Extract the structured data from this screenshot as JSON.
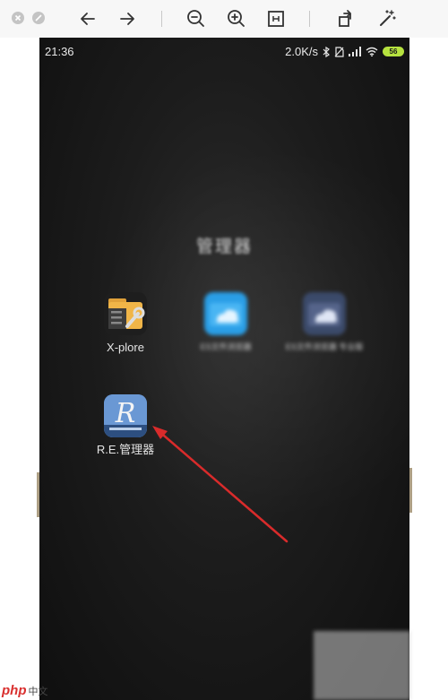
{
  "toolbar": {
    "icons": [
      "close-window-icon",
      "minimize-window-icon",
      "back-arrow-icon",
      "forward-arrow-icon",
      "zoom-out-icon",
      "zoom-in-icon",
      "fit-page-icon",
      "rotate-icon",
      "magic-wand-icon"
    ]
  },
  "status_bar": {
    "time": "21:36",
    "network_speed": "2.0K/s",
    "battery": "56",
    "battery_color": "#b6e23f"
  },
  "folder": {
    "title": "管理器",
    "apps": [
      {
        "label": "X-plore"
      },
      {
        "label": "ES文件浏览器"
      },
      {
        "label": "ES文件浏览器 专业版"
      },
      {
        "label": "R.E.管理器"
      }
    ]
  },
  "annotation": {
    "arrow_color": "#d92b2b"
  },
  "watermark": {
    "text": "php",
    "suffix": "中文"
  }
}
